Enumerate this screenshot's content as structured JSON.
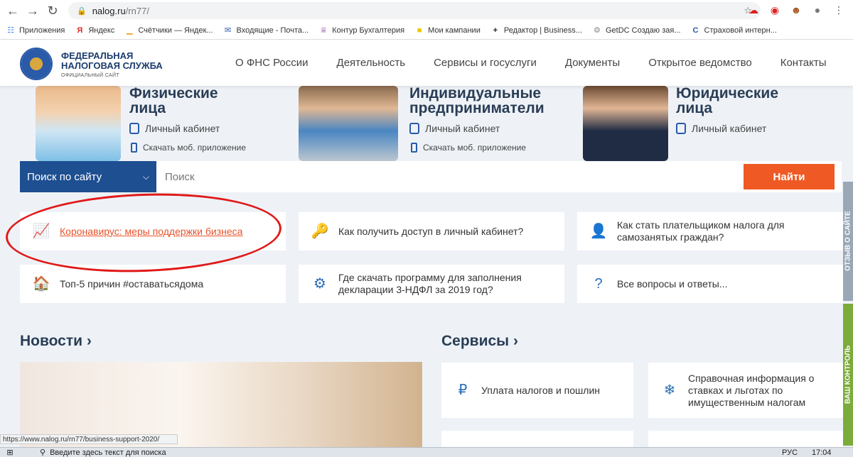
{
  "browser": {
    "url_domain": "nalog.ru",
    "url_path": "/rn77/",
    "status_url": "https://www.nalog.ru/rn77/business-support-2020/"
  },
  "bookmarks": [
    {
      "label": "Приложения",
      "icon": "apps-grid-icon",
      "color": "#4285f4"
    },
    {
      "label": "Яндекс",
      "icon": "yandex-icon",
      "color": "#e52620"
    },
    {
      "label": "Счётчики — Яндек...",
      "icon": "metrika-icon",
      "color": "#f0a020"
    },
    {
      "label": "Входящие - Почта...",
      "icon": "mail-icon",
      "color": "#2a5aa8"
    },
    {
      "label": "Контур Бухгалтерия",
      "icon": "kontur-icon",
      "color": "#7b2d9b"
    },
    {
      "label": "Мои кампании",
      "icon": "campaign-icon",
      "color": "#f2c200"
    },
    {
      "label": "Редактор | Business...",
      "icon": "editor-icon",
      "color": "#222"
    },
    {
      "label": "GetDC Создаю зая...",
      "icon": "getdc-icon",
      "color": "#888"
    },
    {
      "label": "Страховой интерн...",
      "icon": "insurance-icon",
      "color": "#2a5aa8"
    }
  ],
  "site": {
    "logo_line1": "ФЕДЕРАЛЬНАЯ",
    "logo_line2": "НАЛОГОВАЯ СЛУЖБА",
    "logo_sub": "ОФИЦИАЛЬНЫЙ САЙТ",
    "nav": [
      "О ФНС России",
      "Деятельность",
      "Сервисы и госуслуги",
      "Документы",
      "Открытое ведомство",
      "Контакты"
    ]
  },
  "categories": [
    {
      "title1": "Физические",
      "title2": "лица",
      "cabinet": "Личный кабинет",
      "mobile": "Скачать моб. приложение"
    },
    {
      "title1": "Индивидуальные",
      "title2": "предприниматели",
      "cabinet": "Личный кабинет",
      "mobile": "Скачать моб. приложение"
    },
    {
      "title1": "Юридические",
      "title2": "лица",
      "cabinet": "Личный кабинет"
    }
  ],
  "search": {
    "scope": "Поиск по сайту",
    "placeholder": "Поиск",
    "button": "Найти"
  },
  "cards": [
    {
      "text": "Коронавирус: меры поддержки бизнеса",
      "icon": "growth-chart-icon"
    },
    {
      "text": "Как получить доступ в личный кабинет?",
      "icon": "key-cabinet-icon"
    },
    {
      "text": "Как стать плательщиком налога для самозанятых граждан?",
      "icon": "self-employed-icon"
    },
    {
      "text": "Топ-5 причин #оставатьсядома",
      "icon": "house-icon"
    },
    {
      "text": "Где скачать программу для заполнения декларации 3-НДФЛ за 2019 год?",
      "icon": "download-stack-icon"
    },
    {
      "text": "Все вопросы и ответы...",
      "icon": "question-icon"
    }
  ],
  "sections": {
    "news": "Новости",
    "services": "Сервисы"
  },
  "services": [
    {
      "text": "Уплата налогов и пошлин",
      "icon": "phone-ruble-icon"
    },
    {
      "text": "Справочная информация о ставках и льготах по имущественным налогам",
      "icon": "snowflake-icon"
    }
  ],
  "side_tabs": [
    "ОТЗЫВ О САЙТЕ",
    "ВАШ КОНТРОЛЬ"
  ],
  "taskbar": {
    "search_placeholder": "Введите здесь текст для поиска",
    "lang": "РУС",
    "time": "17:04"
  },
  "colors": {
    "brand_blue": "#1d4f91",
    "accent_orange": "#ef5a24",
    "highlight_red": "#e01919"
  }
}
